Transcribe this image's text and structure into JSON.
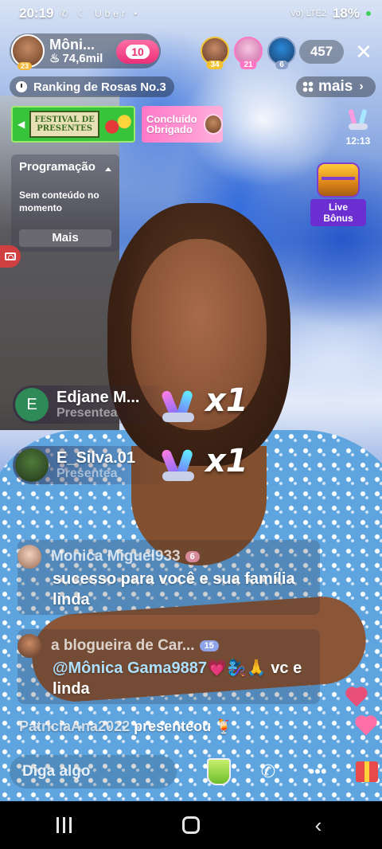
{
  "status_bar": {
    "time": "20:19",
    "notification_icons": "✆ ☾ Uber •",
    "network": "Vo) LTE2",
    "battery": "18%"
  },
  "host": {
    "name": "Môni...",
    "likes": "74,6mil",
    "level": "23",
    "follow_badge": "10"
  },
  "viewers": [
    {
      "rank": "34"
    },
    {
      "rank": "21"
    },
    {
      "rank": "6"
    }
  ],
  "viewer_count": "457",
  "close_icon": "close-icon",
  "ranking": {
    "label": "Ranking de Rosas No.3"
  },
  "more": {
    "label": "mais"
  },
  "banners": {
    "festival_line1": "FESTIVAL DE",
    "festival_line2": "PRESENTES",
    "concluido_line1": "Concluído",
    "concluido_line2": "Obrigado",
    "timer": "12:13"
  },
  "program": {
    "title": "Programação",
    "content": "Sem conteúdo no momento",
    "more_label": "Mais"
  },
  "bonus": {
    "label": "Live Bônus"
  },
  "gifts": [
    {
      "avatar_letter": "E",
      "name": "Edjane M...",
      "action": "Presentea",
      "multiplier": "x1"
    },
    {
      "avatar_letter": "",
      "name": "E_Silva.01",
      "action": "Presentea",
      "multiplier": "x1"
    }
  ],
  "chat": [
    {
      "user": "Monica Miguel933",
      "level": "6",
      "message": "sucesso para você e sua família linda"
    },
    {
      "user": "a blogueira de Car...",
      "level": "15",
      "mention": "@Mônica Gama9887",
      "message_rest": "💗🧞‍♀️🙏 vc e linda"
    }
  ],
  "system_line": {
    "user": "PatriciaAna2022",
    "action": "presenteou"
  },
  "input": {
    "placeholder": "Diga algo"
  },
  "colors": {
    "follow_pink": "#ea2f78",
    "live_bonus_purple": "#6b2fd1",
    "festival_green": "#37c43b",
    "mention_blue": "#aee0ff"
  }
}
